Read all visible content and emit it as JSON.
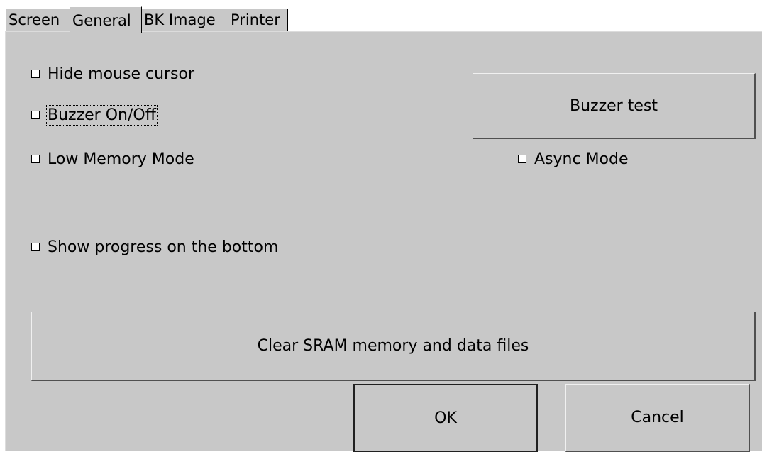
{
  "tabs": [
    {
      "label": "Screen",
      "active": false
    },
    {
      "label": "General",
      "active": true
    },
    {
      "label": "BK Image",
      "active": false
    },
    {
      "label": "Printer",
      "active": false
    }
  ],
  "options": {
    "hide_mouse_cursor": {
      "label": "Hide mouse cursor",
      "checked": false
    },
    "buzzer_on_off": {
      "label": "Buzzer On/Off",
      "checked": false
    },
    "low_memory_mode": {
      "label": "Low Memory Mode",
      "checked": false
    },
    "async_mode": {
      "label": "Async Mode",
      "checked": false
    },
    "show_progress_bottom": {
      "label": "Show progress on the bottom",
      "checked": false
    }
  },
  "buttons": {
    "buzzer_test": "Buzzer test",
    "clear_sram": "Clear SRAM memory and data files",
    "ok": "OK",
    "cancel": "Cancel"
  },
  "colors": {
    "panel_background": "#c8c8c8",
    "checkbox_fill": "#ffffff"
  }
}
